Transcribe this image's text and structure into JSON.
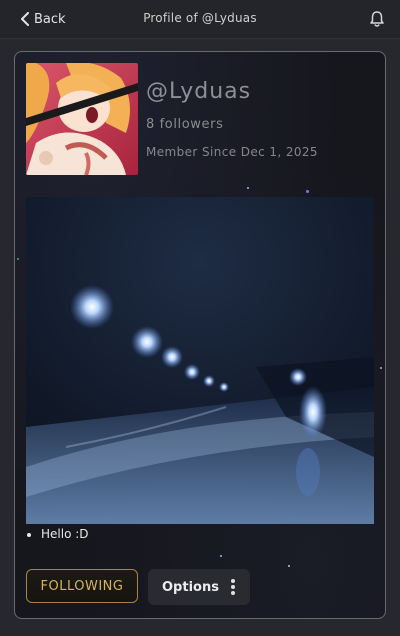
{
  "header": {
    "back_label": "Back",
    "title": "Profile of @Lyduas",
    "back_icon": "chevron-left-icon",
    "notification_icon": "bell-icon"
  },
  "profile": {
    "username": "@Lyduas",
    "followers": "8 followers",
    "member_since": "Member Since Dec 1, 2025",
    "bio": [
      "Hello :D"
    ]
  },
  "actions": {
    "following_label": "FOLLOWING",
    "options_label": "Options",
    "options_icon": "vertical-dots-icon"
  },
  "colors": {
    "accent_gold": "#d8b35e",
    "card_border": "#6a6b72",
    "background": "#27282d"
  }
}
